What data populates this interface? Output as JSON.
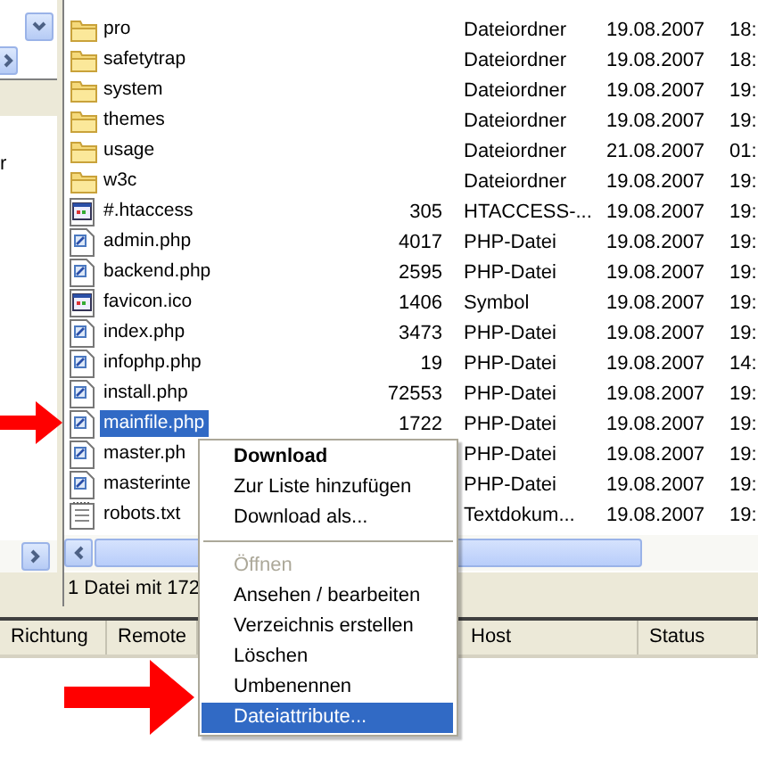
{
  "left_pane": {
    "text": "r"
  },
  "files": [
    {
      "kind": "folder",
      "name": "pro",
      "type": "Dateiordner",
      "date": "19.08.2007",
      "time": "18:",
      "selected": false
    },
    {
      "kind": "folder",
      "name": "safetytrap",
      "type": "Dateiordner",
      "date": "19.08.2007",
      "time": "18:",
      "selected": false
    },
    {
      "kind": "folder",
      "name": "system",
      "type": "Dateiordner",
      "date": "19.08.2007",
      "time": "19:",
      "selected": false
    },
    {
      "kind": "folder",
      "name": "themes",
      "type": "Dateiordner",
      "date": "19.08.2007",
      "time": "19:",
      "selected": false
    },
    {
      "kind": "folder",
      "name": "usage",
      "type": "Dateiordner",
      "date": "21.08.2007",
      "time": "01:",
      "selected": false
    },
    {
      "kind": "folder",
      "name": "w3c",
      "type": "Dateiordner",
      "date": "19.08.2007",
      "time": "19:",
      "selected": false
    },
    {
      "kind": "system",
      "name": "#.htaccess",
      "size": "305",
      "type": "HTACCESS-...",
      "date": "19.08.2007",
      "time": "19:",
      "selected": false
    },
    {
      "kind": "script",
      "name": "admin.php",
      "size": "4017",
      "type": "PHP-Datei",
      "date": "19.08.2007",
      "time": "19:",
      "selected": false
    },
    {
      "kind": "script",
      "name": "backend.php",
      "size": "2595",
      "type": "PHP-Datei",
      "date": "19.08.2007",
      "time": "19:",
      "selected": false
    },
    {
      "kind": "system",
      "name": "favicon.ico",
      "size": "1406",
      "type": "Symbol",
      "date": "19.08.2007",
      "time": "19:",
      "selected": false
    },
    {
      "kind": "script",
      "name": "index.php",
      "size": "3473",
      "type": "PHP-Datei",
      "date": "19.08.2007",
      "time": "19:",
      "selected": false
    },
    {
      "kind": "script",
      "name": "infophp.php",
      "size": "19",
      "type": "PHP-Datei",
      "date": "19.08.2007",
      "time": "14:",
      "selected": false
    },
    {
      "kind": "script",
      "name": "install.php",
      "size": "72553",
      "type": "PHP-Datei",
      "date": "19.08.2007",
      "time": "19:",
      "selected": false
    },
    {
      "kind": "script",
      "name": "mainfile.php",
      "size": "1722",
      "type": "PHP-Datei",
      "date": "19.08.2007",
      "time": "19:",
      "selected": true
    },
    {
      "kind": "script",
      "name": "master.ph",
      "type": "PHP-Datei",
      "date": "19.08.2007",
      "time": "19:",
      "selected": false
    },
    {
      "kind": "script",
      "name": "masterinte",
      "type": "PHP-Datei",
      "date": "19.08.2007",
      "time": "19:",
      "selected": false
    },
    {
      "kind": "text",
      "name": "robots.txt",
      "type": "Textdokum...",
      "date": "19.08.2007",
      "time": "19:",
      "selected": false
    }
  ],
  "status_bar": "1 Datei mit 172",
  "queue_columns": [
    {
      "label": "Richtung"
    },
    {
      "label": "Remote"
    },
    {
      "label": "Host"
    },
    {
      "label": "Status"
    }
  ],
  "context_menu": [
    {
      "kind": "item",
      "label": "Download",
      "default": true,
      "disabled": false,
      "selected": false
    },
    {
      "kind": "item",
      "label": "Zur Liste hinzufügen",
      "default": false,
      "disabled": false,
      "selected": false
    },
    {
      "kind": "item",
      "label": "Download als...",
      "default": false,
      "disabled": false,
      "selected": false
    },
    {
      "kind": "separator"
    },
    {
      "kind": "item",
      "label": "Öffnen",
      "default": false,
      "disabled": true,
      "selected": false
    },
    {
      "kind": "item",
      "label": "Ansehen / bearbeiten",
      "default": false,
      "disabled": false,
      "selected": false
    },
    {
      "kind": "item",
      "label": "Verzeichnis erstellen",
      "default": false,
      "disabled": false,
      "selected": false
    },
    {
      "kind": "item",
      "label": "Löschen",
      "default": false,
      "disabled": false,
      "selected": false
    },
    {
      "kind": "item",
      "label": "Umbenennen",
      "default": false,
      "disabled": false,
      "selected": false
    },
    {
      "kind": "item",
      "label": "Dateiattribute...",
      "default": false,
      "disabled": false,
      "selected": true
    }
  ]
}
